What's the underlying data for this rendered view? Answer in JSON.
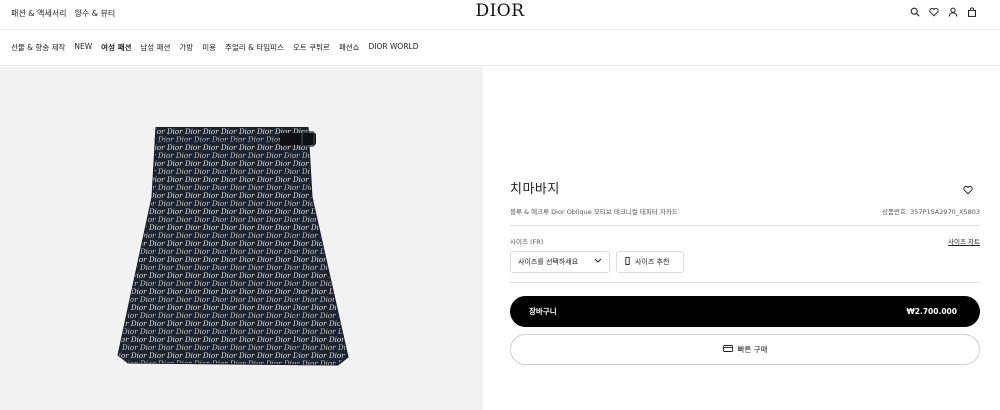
{
  "header": {
    "top_links": [
      "패션 & 액세서리",
      "향수 & 뷰티"
    ],
    "logo": "DIOR",
    "icons": [
      "search-icon",
      "heart-icon",
      "user-icon",
      "bag-icon"
    ]
  },
  "nav": {
    "items": [
      "선물 & 향송 제작",
      "NEW",
      "여성 패션",
      "남성 패션",
      "가방",
      "미용",
      "주얼리 & 타임피스",
      "오트 쿠튀르",
      "패션쇼",
      "DIOR WORLD"
    ]
  },
  "product": {
    "title": "치마바지",
    "subtitle": "블루 & 에크루 Dior Oblique 모티브 테크니컬 태피터 자카드",
    "reference": "상품번호: 357P15A2970_X5803",
    "size_label": "사이즈 (FR)",
    "size_chart": "사이즈 차트",
    "size_select_placeholder": "사이즈를 선택하세요",
    "size_recommend": "사이즈 추천",
    "add_to_cart": "장바구니",
    "price": "₩2.700.000",
    "quick_buy": "빠른 구매"
  },
  "colors": {
    "navy": "#1c2333",
    "ecru": "#e9e4da",
    "image_bg": "#f2f2f2",
    "cart_bg": "#000000"
  }
}
